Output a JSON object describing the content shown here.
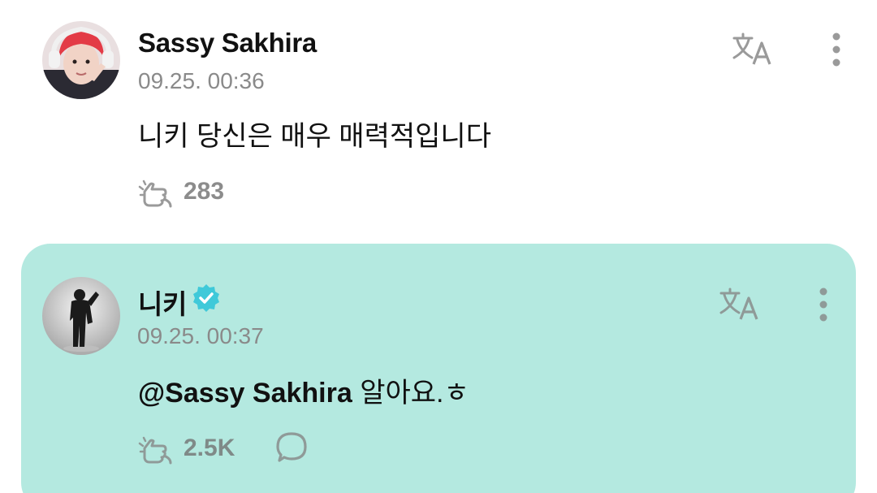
{
  "post": {
    "author": "Sassy Sakhira",
    "timestamp": "09.25. 00:36",
    "text": "니키 당신은 매우 매력적입니다",
    "like_count": "283",
    "icons": {
      "translate": "translate-icon",
      "more": "more-vertical-icon",
      "like": "like-hand-icon"
    }
  },
  "reply": {
    "author": "니키",
    "verified": true,
    "timestamp": "09.25. 00:37",
    "mention": "@Sassy Sakhira",
    "text": " 알아요.ㅎ",
    "like_count": "2.5K",
    "icons": {
      "translate": "translate-icon",
      "more": "more-vertical-icon",
      "like": "like-hand-icon",
      "comment": "comment-bubble-icon",
      "verified": "verified-badge-icon"
    }
  },
  "colors": {
    "reply_background": "#b4e9e0",
    "verified_badge": "#3fc9d9",
    "muted_text": "#8a8a8a",
    "icon_gray": "#9a9a9a"
  }
}
